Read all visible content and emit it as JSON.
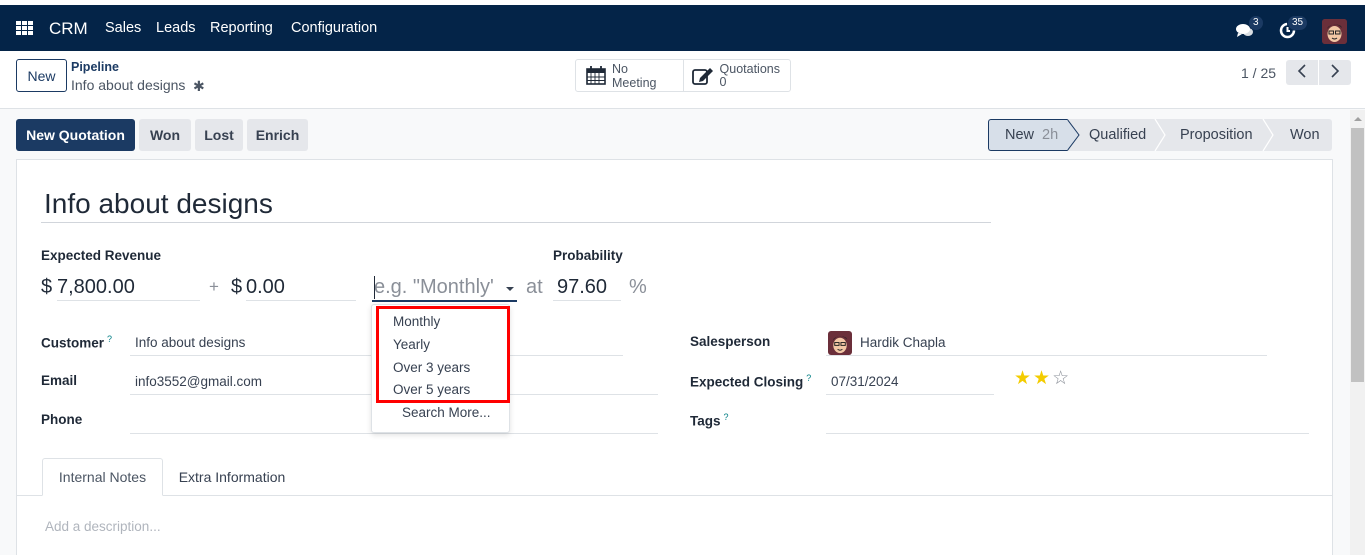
{
  "navbar": {
    "app_name": "CRM",
    "menu": [
      "Sales",
      "Leads",
      "Reporting",
      "Configuration"
    ],
    "messages_count": "3",
    "activities_count": "35",
    "icons": [
      "apps-grid-icon",
      "chat-icon",
      "clock-icon",
      "user-avatar"
    ]
  },
  "control_panel": {
    "new_label": "New",
    "breadcrumb_parent": "Pipeline",
    "breadcrumb_current": "Info about designs",
    "meeting_label": "No Meeting",
    "quotations_label": "Quotations",
    "quotations_count": "0",
    "pager": "1 / 25",
    "prev": "<",
    "next": ">"
  },
  "actions": {
    "new_quotation": "New Quotation",
    "won": "Won",
    "lost": "Lost",
    "enrich": "Enrich"
  },
  "stages": {
    "items": [
      "New",
      "Qualified",
      "Proposition",
      "Won"
    ],
    "active": "New",
    "active_time": "2h"
  },
  "form": {
    "title": "Info about designs",
    "expected_revenue_label": "Expected Revenue",
    "currency": "$",
    "expected_revenue": "7,800.00",
    "plus": "+",
    "recurring_revenue": "0.00",
    "recurring_plan_placeholder": "e.g. \"Monthly'",
    "at": "at",
    "probability_label": "Probability",
    "probability": "97.60",
    "percent": "%",
    "customer_label": "Customer",
    "customer": "Info about designs",
    "email_label": "Email",
    "email": "info3552@gmail.com",
    "phone_label": "Phone",
    "phone": "",
    "salesperson_label": "Salesperson",
    "salesperson": "Hardik Chapla",
    "expected_closing_label": "Expected Closing",
    "expected_closing": "07/31/2024",
    "priority_stars": 2,
    "priority_max": 3,
    "tags_label": "Tags",
    "help_mark": "?"
  },
  "dropdown": {
    "options": [
      "Monthly",
      "Yearly",
      "Over 3 years",
      "Over 5 years"
    ],
    "search_more": "Search More..."
  },
  "tabs": {
    "items": [
      "Internal Notes",
      "Extra Information"
    ],
    "active": "Internal Notes",
    "description_placeholder": "Add a description..."
  },
  "colors": {
    "navbar": "#042448",
    "primary": "#1b3a63",
    "highlight": "#ff0000",
    "star": "#f3cc00"
  }
}
